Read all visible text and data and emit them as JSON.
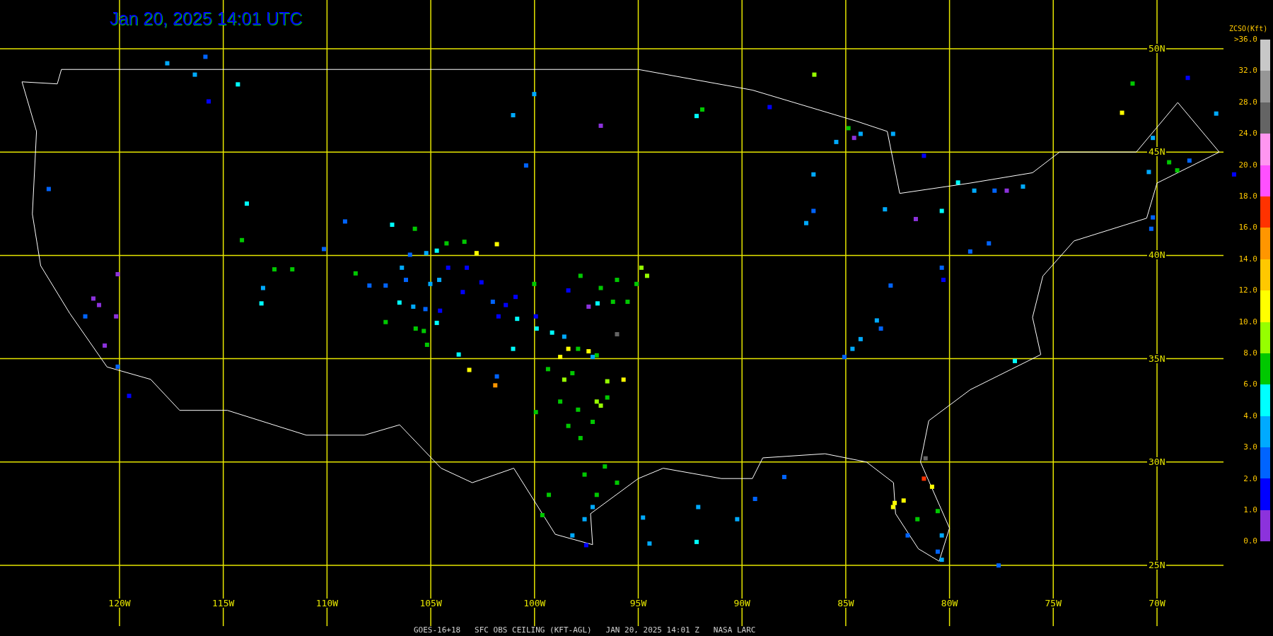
{
  "title": "Jan 20, 2025 14:01 UTC",
  "latitudes": [
    {
      "label": "50N"
    },
    {
      "label": "45N"
    },
    {
      "label": "40N"
    },
    {
      "label": "35N"
    },
    {
      "label": "30N"
    },
    {
      "label": "25N"
    }
  ],
  "longitudes": [
    {
      "label": "120W"
    },
    {
      "label": "115W"
    },
    {
      "label": "110W"
    },
    {
      "label": "105W"
    },
    {
      "label": "100W"
    },
    {
      "label": "95W"
    },
    {
      "label": "90W"
    },
    {
      "label": "85W"
    },
    {
      "label": "80W"
    },
    {
      "label": "75W"
    },
    {
      "label": "70W"
    }
  ],
  "colorbar": {
    "title": "ZCSO(Kft)",
    "ticks": [
      ">36.0",
      "32.0",
      "28.0",
      "24.0",
      "20.0",
      "18.0",
      "16.0",
      "14.0",
      "12.0",
      "10.0",
      "8.0",
      "6.0",
      "4.0",
      "3.0",
      "2.0",
      "1.0",
      "0.0"
    ],
    "segments": [
      {
        "color": "#c8c8c8"
      },
      {
        "color": "#969696"
      },
      {
        "color": "#646464"
      },
      {
        "color": "#ff96f0"
      },
      {
        "color": "#ff50ff"
      },
      {
        "color": "#ff3200"
      },
      {
        "color": "#ff9600"
      },
      {
        "color": "#ffc800"
      },
      {
        "color": "#ffff00"
      },
      {
        "color": "#96ff00"
      },
      {
        "color": "#00c800"
      },
      {
        "color": "#00ffff"
      },
      {
        "color": "#00aaff"
      },
      {
        "color": "#0064ff"
      },
      {
        "color": "#0000ff"
      },
      {
        "color": "#8c32dc"
      }
    ]
  },
  "caption": "GOES-16+18   SFC OBS CEILING (KFT-AGL)   JAN 20, 2025 14:01 Z   NASA LARC"
}
